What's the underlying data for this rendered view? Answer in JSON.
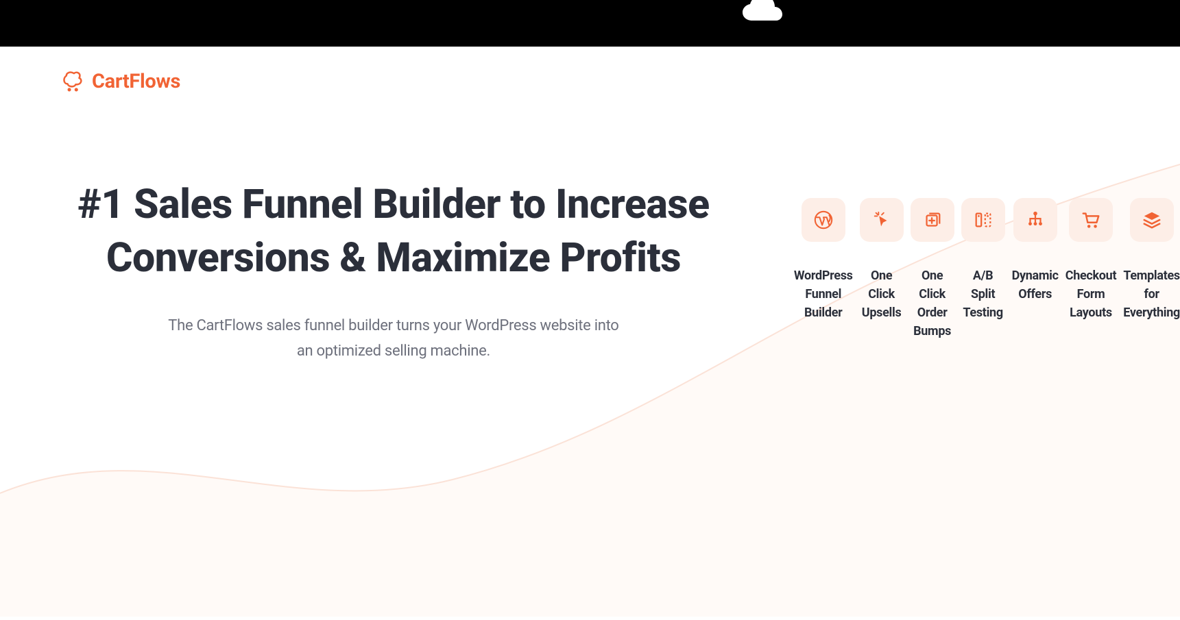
{
  "brand": {
    "name": "CartFlows"
  },
  "hero": {
    "title": "#1 Sales Funnel Builder to Increase Conversions & Maximize Profits",
    "subtitle_line1": "The CartFlows sales funnel builder turns your WordPress website into",
    "subtitle_line2": "an optimized selling machine."
  },
  "features": [
    {
      "icon": "wordpress-icon",
      "label": "WordPress\nFunnel Builder"
    },
    {
      "icon": "cursor-icon",
      "label": "One Click\nUpsells"
    },
    {
      "icon": "add-page-icon",
      "label": "One Click\nOrder Bumps"
    },
    {
      "icon": "split-icon",
      "label": "A/B Split\nTesting"
    },
    {
      "icon": "tree-icon",
      "label": "Dynamic\nOffers"
    },
    {
      "icon": "cart-icon",
      "label": "Checkout Form\nLayouts"
    },
    {
      "icon": "layers-icon",
      "label": "Templates for\nEverything"
    }
  ]
}
